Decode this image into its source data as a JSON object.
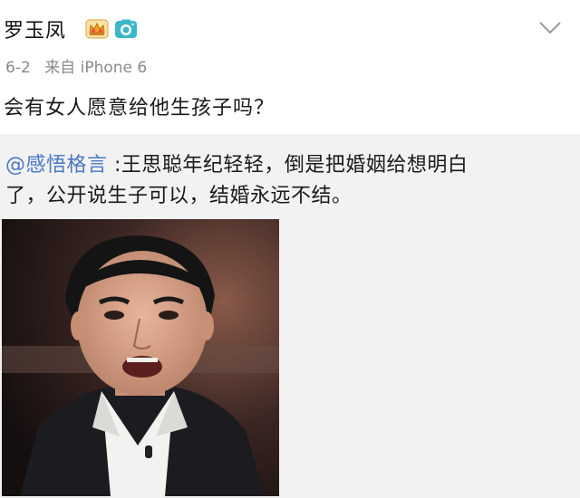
{
  "post": {
    "username": "罗玉凤",
    "date": "6-2",
    "source": "来自 iPhone 6",
    "text": "会有女人愿意给他生孩子吗？",
    "icons": [
      "crown-badge-icon",
      "camera-badge-icon",
      "chevron-down-icon"
    ]
  },
  "repost": {
    "mention": "@感悟格言",
    "text_line1": " :王思聪年纪轻轻，倒是把婚姻给想明白",
    "text_line2": "了，公开说生子可以，结婚永远不结。"
  },
  "colors": {
    "mention": "#4a77c7",
    "meta": "#8a8a8a",
    "repost_bg": "#f2f2f2"
  }
}
